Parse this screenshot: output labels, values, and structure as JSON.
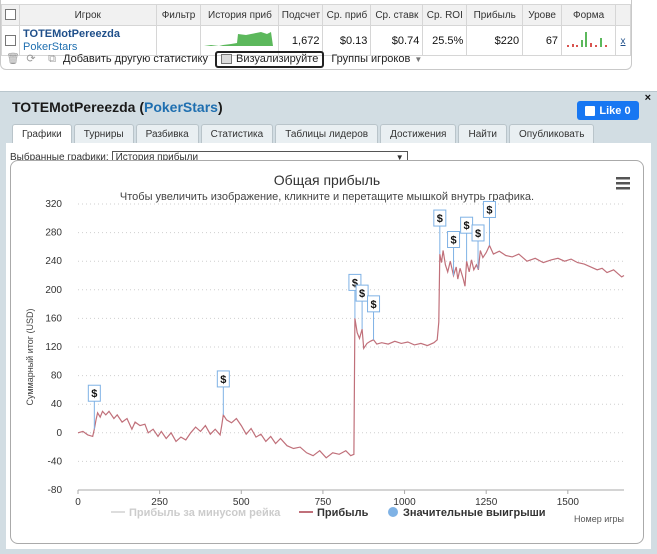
{
  "stats_table": {
    "headers": [
      "",
      "Игрок",
      "Фильтр",
      "История приб",
      "Подсчет",
      "Ср. приб",
      "Ср. ставк",
      "Ср. ROI",
      "Прибыль",
      "Урове",
      "Форма",
      ""
    ],
    "row": {
      "player": "TOTEMotPereezda",
      "network": "PokerStars",
      "filter": "",
      "count": "1,672",
      "avg_profit": "$0.13",
      "avg_stake": "$0.74",
      "avg_roi": "25.5%",
      "profit": "$220",
      "level": "67",
      "remove": "x"
    }
  },
  "toolbar": {
    "add_stats": "Добавить другую статистику",
    "visualize": "Визуализируйте",
    "groups": "Группы игроков"
  },
  "panel": {
    "player": "TOTEMotPereezda",
    "network": "PokerStars",
    "like": "Like 0",
    "close": "×",
    "tabs": [
      "Графики",
      "Турниры",
      "Разбивка",
      "Статистика",
      "Таблицы лидеров",
      "Достижения",
      "Найти",
      "Опубликовать"
    ],
    "active_tab": 0,
    "select_label": "Выбранные графики:",
    "select_value": "История прибыли"
  },
  "chart_data": {
    "type": "line",
    "title": "Общая прибыль",
    "subtitle": "Чтобы увеличить изображение, кликните и перетащите мышкой внутрь графика.",
    "xlabel": "Номер игры",
    "ylabel": "Суммарный итог (USD)",
    "xlim": [
      0,
      1672
    ],
    "ylim": [
      -80,
      320
    ],
    "x_ticks": [
      0,
      250,
      500,
      750,
      1000,
      1250,
      1500
    ],
    "y_ticks": [
      -80,
      -40,
      0,
      40,
      80,
      120,
      160,
      200,
      240,
      280,
      320
    ],
    "grid": "horizontal dotted",
    "series": [
      {
        "name": "Прибыль",
        "color": "#c0707a",
        "points": [
          [
            0,
            0
          ],
          [
            15,
            2
          ],
          [
            30,
            -3
          ],
          [
            45,
            -5
          ],
          [
            50,
            5
          ],
          [
            55,
            18
          ],
          [
            60,
            28
          ],
          [
            68,
            22
          ],
          [
            75,
            30
          ],
          [
            85,
            25
          ],
          [
            95,
            30
          ],
          [
            110,
            20
          ],
          [
            120,
            25
          ],
          [
            135,
            15
          ],
          [
            150,
            20
          ],
          [
            165,
            5
          ],
          [
            175,
            15
          ],
          [
            190,
            10
          ],
          [
            205,
            12
          ],
          [
            215,
            0
          ],
          [
            230,
            5
          ],
          [
            245,
            -5
          ],
          [
            255,
            2
          ],
          [
            270,
            -8
          ],
          [
            285,
            0
          ],
          [
            300,
            -12
          ],
          [
            315,
            -6
          ],
          [
            330,
            -10
          ],
          [
            345,
            0
          ],
          [
            360,
            8
          ],
          [
            375,
            2
          ],
          [
            390,
            10
          ],
          [
            405,
            -2
          ],
          [
            420,
            5
          ],
          [
            435,
            -3
          ],
          [
            440,
            10
          ],
          [
            445,
            25
          ],
          [
            455,
            18
          ],
          [
            470,
            14
          ],
          [
            485,
            20
          ],
          [
            500,
            10
          ],
          [
            515,
            -2
          ],
          [
            530,
            6
          ],
          [
            545,
            -6
          ],
          [
            560,
            -2
          ],
          [
            575,
            -12
          ],
          [
            590,
            -5
          ],
          [
            605,
            -15
          ],
          [
            620,
            -8
          ],
          [
            640,
            -18
          ],
          [
            660,
            -22
          ],
          [
            680,
            -20
          ],
          [
            700,
            -28
          ],
          [
            720,
            -32
          ],
          [
            740,
            -25
          ],
          [
            760,
            -35
          ],
          [
            780,
            -28
          ],
          [
            800,
            -30
          ],
          [
            820,
            -25
          ],
          [
            835,
            -32
          ],
          [
            845,
            -30
          ],
          [
            848,
            160
          ],
          [
            855,
            140
          ],
          [
            862,
            132
          ],
          [
            870,
            145
          ],
          [
            875,
            118
          ],
          [
            885,
            125
          ],
          [
            895,
            128
          ],
          [
            905,
            130
          ],
          [
            915,
            124
          ],
          [
            930,
            126
          ],
          [
            950,
            124
          ],
          [
            970,
            128
          ],
          [
            990,
            125
          ],
          [
            1010,
            127
          ],
          [
            1030,
            123
          ],
          [
            1050,
            125
          ],
          [
            1070,
            122
          ],
          [
            1090,
            126
          ],
          [
            1100,
            130
          ],
          [
            1105,
            155
          ],
          [
            1108,
            250
          ],
          [
            1113,
            238
          ],
          [
            1118,
            255
          ],
          [
            1125,
            235
          ],
          [
            1132,
            225
          ],
          [
            1140,
            240
          ],
          [
            1150,
            220
          ],
          [
            1158,
            232
          ],
          [
            1163,
            215
          ],
          [
            1170,
            230
          ],
          [
            1180,
            215
          ],
          [
            1185,
            205
          ],
          [
            1190,
            240
          ],
          [
            1198,
            225
          ],
          [
            1205,
            242
          ],
          [
            1212,
            228
          ],
          [
            1220,
            235
          ],
          [
            1226,
            228
          ],
          [
            1232,
            255
          ],
          [
            1240,
            245
          ],
          [
            1250,
            252
          ],
          [
            1260,
            262
          ],
          [
            1272,
            250
          ],
          [
            1290,
            254
          ],
          [
            1310,
            248
          ],
          [
            1330,
            246
          ],
          [
            1350,
            250
          ],
          [
            1375,
            240
          ],
          [
            1400,
            244
          ],
          [
            1425,
            238
          ],
          [
            1450,
            242
          ],
          [
            1470,
            244
          ],
          [
            1490,
            240
          ],
          [
            1510,
            243
          ],
          [
            1530,
            238
          ],
          [
            1550,
            236
          ],
          [
            1570,
            232
          ],
          [
            1590,
            228
          ],
          [
            1605,
            230
          ],
          [
            1620,
            224
          ],
          [
            1640,
            228
          ],
          [
            1655,
            222
          ],
          [
            1665,
            218
          ],
          [
            1672,
            220
          ]
        ]
      },
      {
        "name": "Прибыль за минусом рейка",
        "color": "#dddddd",
        "visible": false,
        "values": []
      }
    ],
    "big_wins": {
      "name": "Значительные выигрыши",
      "marker": "$",
      "x": [
        50,
        445,
        848,
        870,
        905,
        1108,
        1150,
        1190,
        1225,
        1260
      ]
    },
    "legend": [
      "Прибыль за минусом рейка",
      "Прибыль",
      "Значительные выигрыши"
    ],
    "legend_position": "bottom"
  }
}
